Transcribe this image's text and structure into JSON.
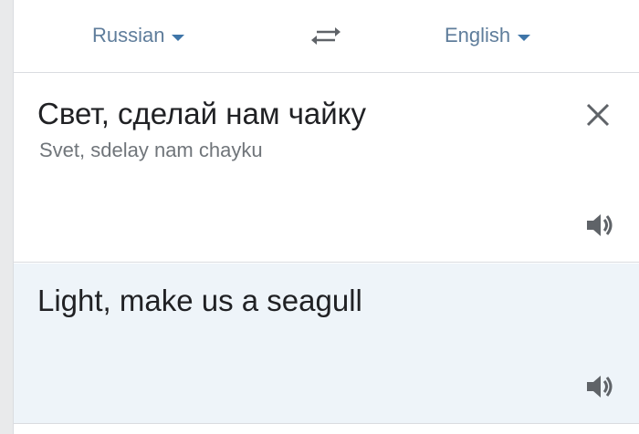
{
  "language_bar": {
    "source_language": "Russian",
    "target_language": "English",
    "swap_icon": "swap-arrows-icon",
    "accent_color": "#3f75a8"
  },
  "source": {
    "text": "Свет, сделай нам чайку",
    "transliteration": "Svet, sdelay nam chayku",
    "clear_icon": "close-icon",
    "listen_icon": "speaker-icon"
  },
  "result": {
    "text": "Light, make us a seagull",
    "listen_icon": "speaker-icon",
    "background": "#eef4f9"
  }
}
